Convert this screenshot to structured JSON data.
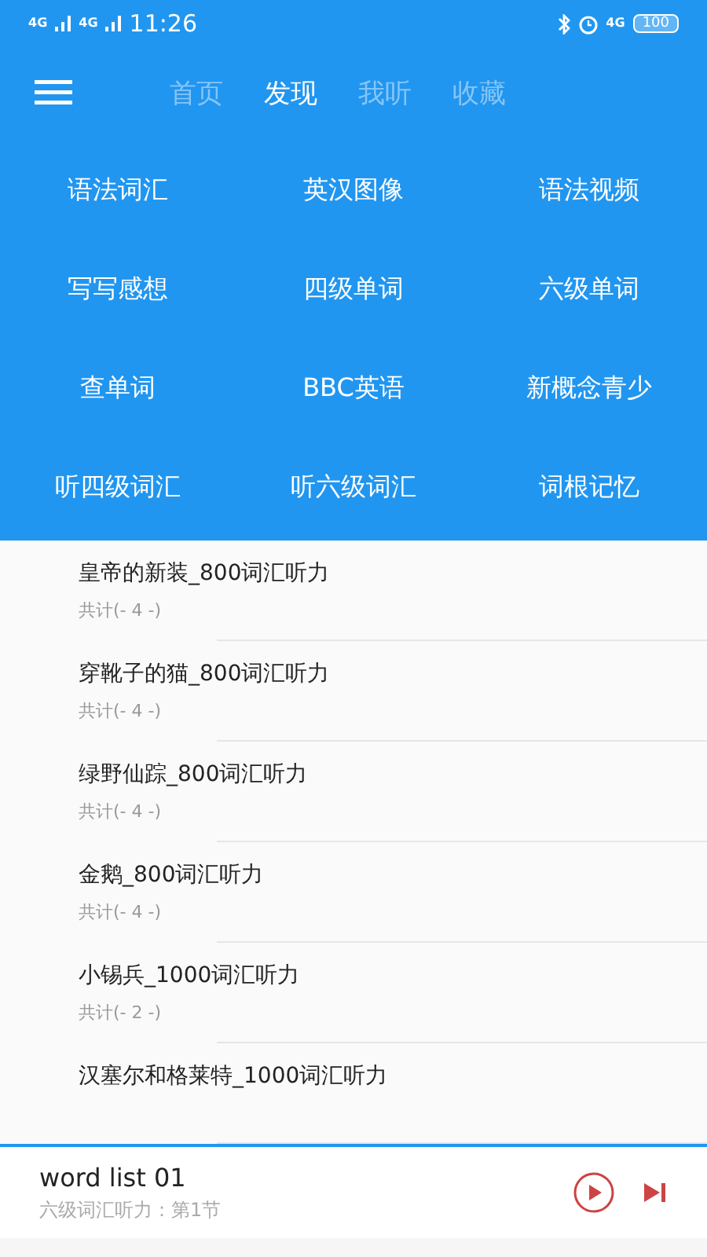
{
  "status_bar": {
    "network_1": "4G",
    "network_2": "4G",
    "time": "11:26",
    "network_3": "4G",
    "battery": "100"
  },
  "tabs": [
    {
      "label": "首页",
      "selected": false
    },
    {
      "label": "发现",
      "selected": true
    },
    {
      "label": "我听",
      "selected": false
    },
    {
      "label": "收藏",
      "selected": false
    }
  ],
  "categories": [
    "语法词汇",
    "英汉图像",
    "语法视频",
    "写写感想",
    "四级单词",
    "六级单词",
    "查单词",
    "BBC英语",
    "新概念青少",
    "听四级词汇",
    "听六级词汇",
    "词根记忆"
  ],
  "list": [
    {
      "title": "皇帝的新装_800词汇听力",
      "count": "共计(- 4 -)"
    },
    {
      "title": "穿靴子的猫_800词汇听力",
      "count": "共计(- 4 -)"
    },
    {
      "title": "绿野仙踪_800词汇听力",
      "count": "共计(- 4 -)"
    },
    {
      "title": "金鹅_800词汇听力",
      "count": "共计(- 4 -)"
    },
    {
      "title": "小锡兵_1000词汇听力",
      "count": "共计(- 2 -)"
    },
    {
      "title": "汉塞尔和格莱特_1000词汇听力"
    }
  ],
  "player": {
    "title": "word list 01",
    "subtitle": "六级词汇听力：第1节"
  }
}
